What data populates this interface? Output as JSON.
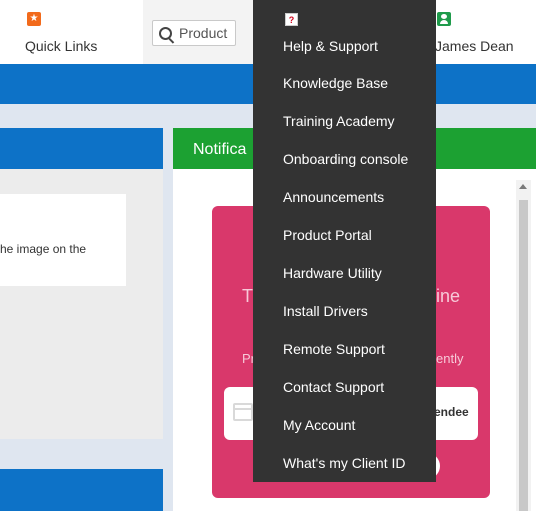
{
  "topbar": {
    "quick_links": {
      "label": "Quick Links",
      "icon": "star-icon",
      "icon_color": "#f26a1b"
    },
    "search": {
      "placeholder": "Product",
      "icon": "search-icon"
    },
    "help": {
      "label": "Help & Support",
      "icon": "question-icon",
      "icon_color": "#d0021b"
    },
    "user": {
      "label": "James Dean",
      "icon": "user-icon",
      "icon_color": "#1f9b4b"
    }
  },
  "help_menu": {
    "items": [
      "Knowledge Base",
      "Training Academy",
      "Onboarding console",
      "Announcements",
      "Product Portal",
      "Hardware Utility",
      "Install Drivers",
      "Remote Support",
      "Contact Support",
      "My Account",
      "What's my Client ID"
    ]
  },
  "left_panel": {
    "card_text": "he image on the"
  },
  "notifications": {
    "title": "Notifica",
    "promo": {
      "title_left": "T",
      "title_right": "ine",
      "subtitle_left": "Pr",
      "subtitle_right": "ently",
      "input_text": "endee",
      "input_icon": "calendar-icon"
    }
  },
  "colors": {
    "header_blue": "#0d72c7",
    "notif_green": "#1ca132",
    "menu_bg": "#333333",
    "promo_pink": "#d9386b"
  }
}
